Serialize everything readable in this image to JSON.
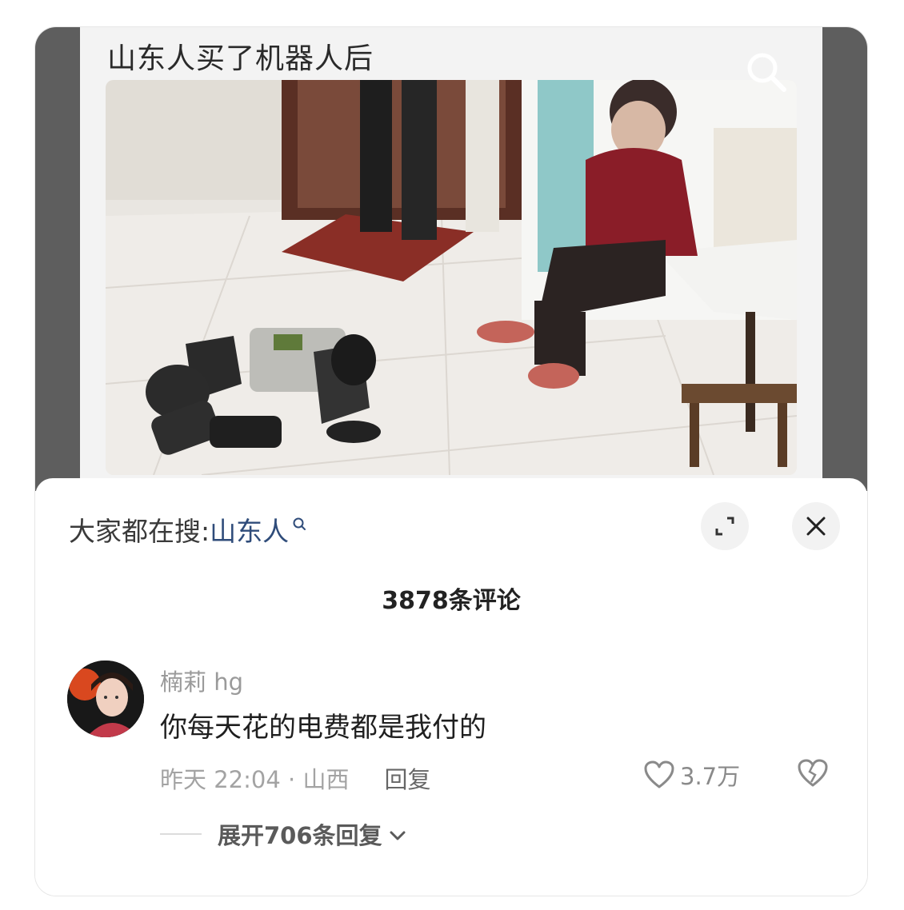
{
  "video": {
    "caption": "山东人买了机器人后"
  },
  "panel": {
    "hot_search_label": "大家都在搜:",
    "hot_search_keyword": "山东人",
    "comment_count": "3878条评论"
  },
  "comment": {
    "username": "楠莉 hg",
    "text": "你每天花的电费都是我付的",
    "time_location": "昨天 22:04 · 山西",
    "reply_label": "回复",
    "like_count": "3.7万",
    "expand_replies": "展开706条回复"
  },
  "icons": {
    "search": "search-icon",
    "mini_search": "search-icon",
    "expand": "expand-icon",
    "close": "close-icon",
    "like": "heart-icon",
    "dislike": "broken-heart-icon",
    "chevron": "chevron-down-icon"
  },
  "colors": {
    "keyword": "#2f4c7a",
    "video_bg": "#5e5e5e",
    "muted": "#9a9a9a"
  }
}
